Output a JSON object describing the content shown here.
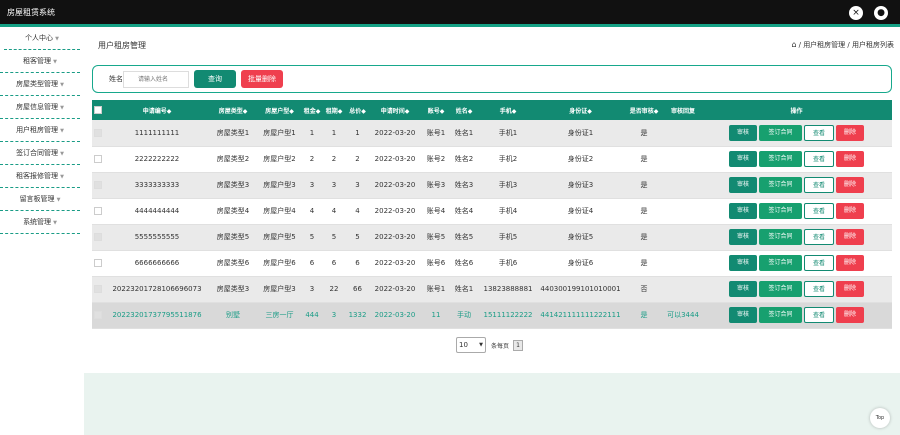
{
  "app": {
    "title": "房屋租赁系统"
  },
  "icons": {
    "close": "×",
    "user": "●",
    "home": "⌂",
    "top": "Top"
  },
  "sidebar": {
    "items": [
      {
        "label": "个人中心"
      },
      {
        "label": "租客管理"
      },
      {
        "label": "房屋类型管理"
      },
      {
        "label": "房屋信息管理"
      },
      {
        "label": "用户租房管理"
      },
      {
        "label": "签订合同管理"
      },
      {
        "label": "租客报修管理"
      },
      {
        "label": "留言板管理"
      },
      {
        "label": "系统管理"
      }
    ]
  },
  "header": {
    "title": "用户租房管理"
  },
  "breadcrumb": [
    "用户租房管理",
    "用户租房列表"
  ],
  "search": {
    "label": "姓名",
    "placeholder": "请输入姓名",
    "search_button": "查询",
    "batch_delete_button": "批量删除"
  },
  "table": {
    "columns": [
      "申请编号◆",
      "房屋类型◆",
      "房屋户型◆",
      "租金◆",
      "租期◆",
      "总价◆",
      "申请时间◆",
      "账号◆",
      "姓名◆",
      "手机◆",
      "身份证◆",
      "是否审核◆",
      "审核回复",
      "操作"
    ],
    "rows": [
      [
        "1111111111",
        "房屋类型1",
        "房屋户型1",
        "1",
        "1",
        "1",
        "2022-03-20",
        "账号1",
        "姓名1",
        "手机1",
        "身份证1",
        "是",
        ""
      ],
      [
        "2222222222",
        "房屋类型2",
        "房屋户型2",
        "2",
        "2",
        "2",
        "2022-03-20",
        "账号2",
        "姓名2",
        "手机2",
        "身份证2",
        "是",
        ""
      ],
      [
        "3333333333",
        "房屋类型3",
        "房屋户型3",
        "3",
        "3",
        "3",
        "2022-03-20",
        "账号3",
        "姓名3",
        "手机3",
        "身份证3",
        "是",
        ""
      ],
      [
        "4444444444",
        "房屋类型4",
        "房屋户型4",
        "4",
        "4",
        "4",
        "2022-03-20",
        "账号4",
        "姓名4",
        "手机4",
        "身份证4",
        "是",
        ""
      ],
      [
        "5555555555",
        "房屋类型5",
        "房屋户型5",
        "5",
        "5",
        "5",
        "2022-03-20",
        "账号5",
        "姓名5",
        "手机5",
        "身份证5",
        "是",
        ""
      ],
      [
        "6666666666",
        "房屋类型6",
        "房屋户型6",
        "6",
        "6",
        "6",
        "2022-03-20",
        "账号6",
        "姓名6",
        "手机6",
        "身份证6",
        "是",
        ""
      ],
      [
        "20223201728106696073",
        "房屋类型3",
        "房屋户型3",
        "3",
        "22",
        "66",
        "2022-03-20",
        "账号1",
        "姓名1",
        "13823888881",
        "440300199101010001",
        "否",
        ""
      ],
      [
        "20223201737795511876",
        "别墅",
        "三房一厅",
        "444",
        "3",
        "1332",
        "2022-03-20",
        "11",
        "手动",
        "15111122222",
        "441421111111222111",
        "是",
        "可以3444"
      ]
    ],
    "actions": {
      "audit": "审核",
      "sign": "签订合同",
      "view": "查看",
      "delete": "删除"
    }
  },
  "pager": {
    "page_size": "10",
    "per_page_label": "条每页",
    "current_page": "1"
  },
  "colors": {
    "accent": "#128a72",
    "danger": "#ef3f4e",
    "topbar": "#111111"
  }
}
